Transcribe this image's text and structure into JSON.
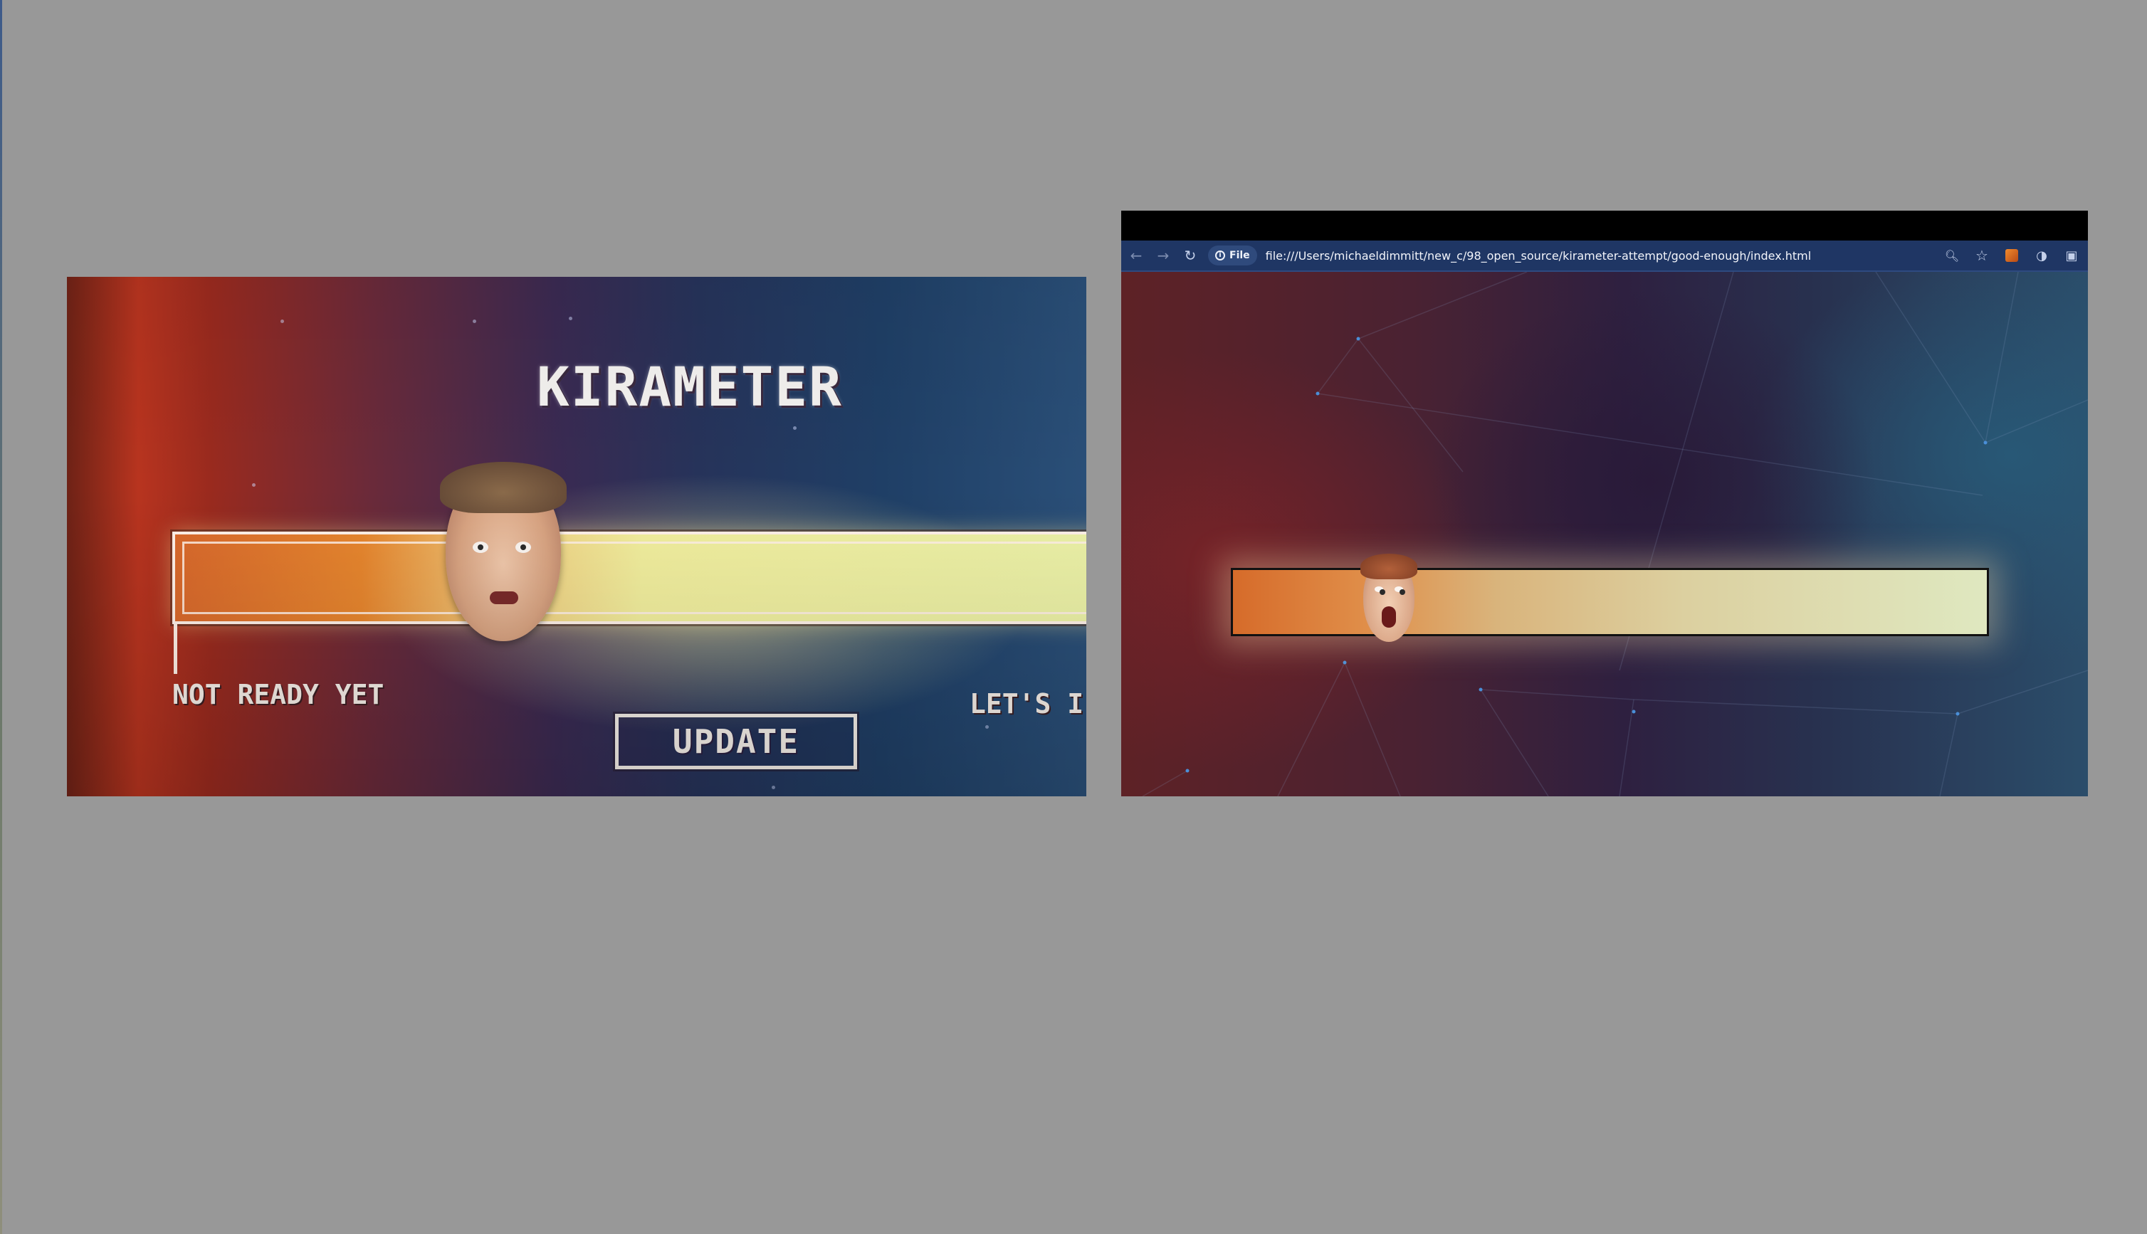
{
  "reference": {
    "title": "KIRAMETER",
    "low_label": "NOT READY YET",
    "high_label": "LET'S I",
    "update_button": "UPDATE",
    "meter_level_fraction": 0.3
  },
  "browser": {
    "nav": {
      "back_icon": "arrow-left-icon",
      "forward_icon": "arrow-right-icon",
      "reload_icon": "reload-icon"
    },
    "site_chip": "File",
    "url": "file:///Users/michaeldimmitt/new_c/98_open_source/kirameter-attempt/good-enough/index.html",
    "right_icons": [
      "zoom-icon",
      "star-icon",
      "extension-orange-icon",
      "palette-icon",
      "puzzle-icon"
    ]
  },
  "page": {
    "meter_level_fraction": 0.2
  },
  "colors": {
    "desktop_bg": "#989898",
    "toolbar_bg": "#1f3664",
    "meter_orange": "#d66b2a",
    "meter_light": "#dfe8c0"
  }
}
